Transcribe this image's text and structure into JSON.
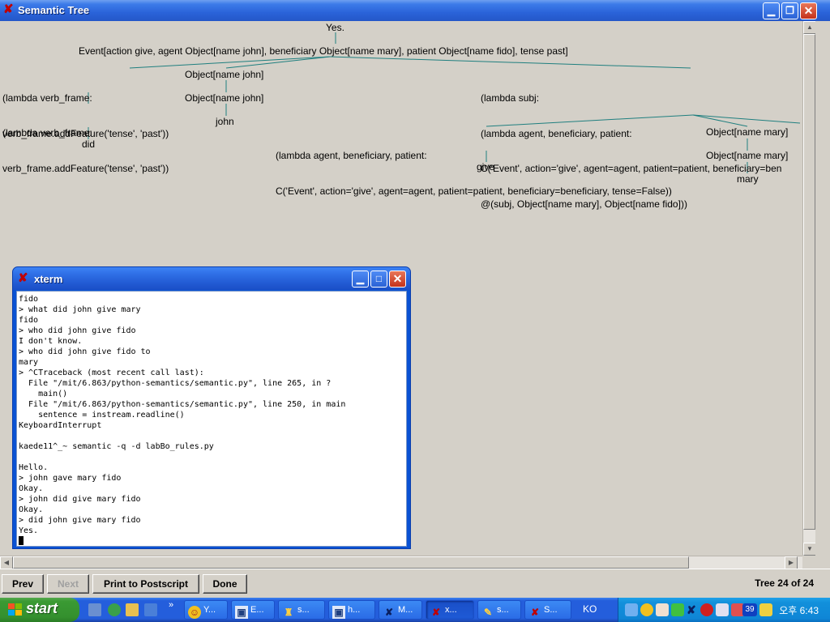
{
  "window": {
    "title": "Semantic Tree"
  },
  "tree": {
    "root": "Yes.",
    "event": "Event[action give, agent Object[name john], beneficiary Object[name mary], patient Object[name fido], tense past]",
    "lambda_verb_1": [
      "(lambda verb_frame:",
      "verb_frame.addFeature('tense', 'past'))"
    ],
    "lambda_verb_2": [
      "(lambda verb_frame:",
      "verb_frame.addFeature('tense', 'past'))"
    ],
    "did": "did",
    "obj_john_1": "Object[name john]",
    "obj_john_2": "Object[name john]",
    "john": "john",
    "lambda_subj": [
      "(lambda subj:",
      "(lambda agent, beneficiary, patient:",
      "C('Event', action='give', agent=agent, patient=patient, beneficiary=ben",
      "@(subj, Object[name mary], Object[name fido]))"
    ],
    "lambda_give": [
      "(lambda agent, beneficiary, patient:",
      "C('Event', action='give', agent=agent, patient=patient, beneficiary=beneficiary, tense=False))"
    ],
    "give": "give",
    "obj_mary_1": "Object[name mary]",
    "obj_mary_2": "Object[name mary]",
    "mary": "mary"
  },
  "toolbar": {
    "prev": "Prev",
    "next": "Next",
    "print": "Print to Postscript",
    "done": "Done",
    "counter": "Tree 24 of 24"
  },
  "xterm": {
    "title": "xterm",
    "lines": [
      "fido",
      "> what did john give mary",
      "fido",
      "> who did john give fido",
      "I don't know.",
      "> who did john give fido to",
      "mary",
      "> ^CTraceback (most recent call last):",
      "  File \"/mit/6.863/python-semantics/semantic.py\", line 265, in ?",
      "    main()",
      "  File \"/mit/6.863/python-semantics/semantic.py\", line 250, in main",
      "    sentence = instream.readline()",
      "KeyboardInterrupt",
      "",
      "kaede11^_~ semantic -q -d labBo_rules.py",
      "",
      "Hello.",
      "> john gave mary fido",
      "Okay.",
      "> john did give mary fido",
      "Okay.",
      "> did john give mary fido",
      "Yes."
    ]
  },
  "taskbar": {
    "start": "start",
    "tasks": [
      "Y...",
      "E...",
      "s...",
      "h...",
      "M...",
      "x...",
      "s...",
      "S..."
    ],
    "lang": "KO",
    "badge": "39",
    "clock": "오후 6:43"
  }
}
